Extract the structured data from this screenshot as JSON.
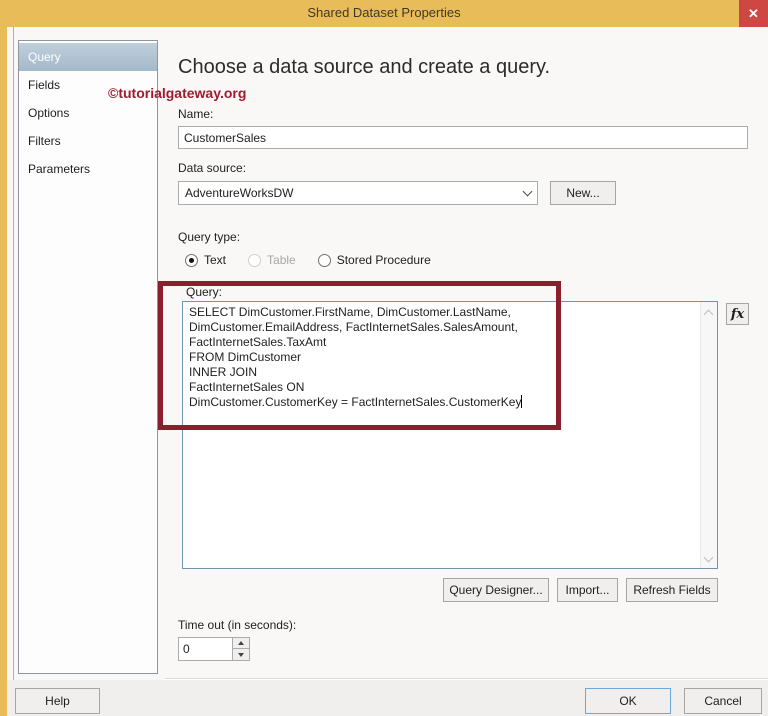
{
  "window": {
    "title": "Shared Dataset Properties",
    "close_glyph": "✕",
    "accent_gold": "#e9bc5a",
    "close_red": "#ce4743"
  },
  "watermark": "©tutorialgateway.org",
  "sidebar": {
    "items": [
      {
        "label": "Query",
        "selected": true
      },
      {
        "label": "Fields",
        "selected": false
      },
      {
        "label": "Options",
        "selected": false
      },
      {
        "label": "Filters",
        "selected": false
      },
      {
        "label": "Parameters",
        "selected": false
      }
    ]
  },
  "main": {
    "heading": "Choose a data source and create a query.",
    "name_label": "Name:",
    "name_value": "CustomerSales",
    "data_source_label": "Data source:",
    "data_source_value": "AdventureWorksDW",
    "new_button": "New...",
    "query_type_label": "Query type:",
    "query_types": [
      {
        "label": "Text",
        "selected": true,
        "disabled": false
      },
      {
        "label": "Table",
        "selected": false,
        "disabled": true
      },
      {
        "label": "Stored Procedure",
        "selected": false,
        "disabled": false
      }
    ],
    "query_label": "Query:",
    "query_text": "SELECT DimCustomer.FirstName, DimCustomer.LastName,\nDimCustomer.EmailAddress, FactInternetSales.SalesAmount,\nFactInternetSales.TaxAmt\nFROM DimCustomer\nINNER JOIN\nFactInternetSales ON\nDimCustomer.CustomerKey = FactInternetSales.CustomerKey",
    "fx_label": "fx",
    "query_designer_button": "Query Designer...",
    "import_button": "Import...",
    "refresh_fields_button": "Refresh Fields",
    "timeout_label": "Time out (in seconds):",
    "timeout_value": "0"
  },
  "annotation": {
    "color": "#8b1f2e"
  },
  "footer": {
    "help_button": "Help",
    "ok_button": "OK",
    "cancel_button": "Cancel"
  }
}
